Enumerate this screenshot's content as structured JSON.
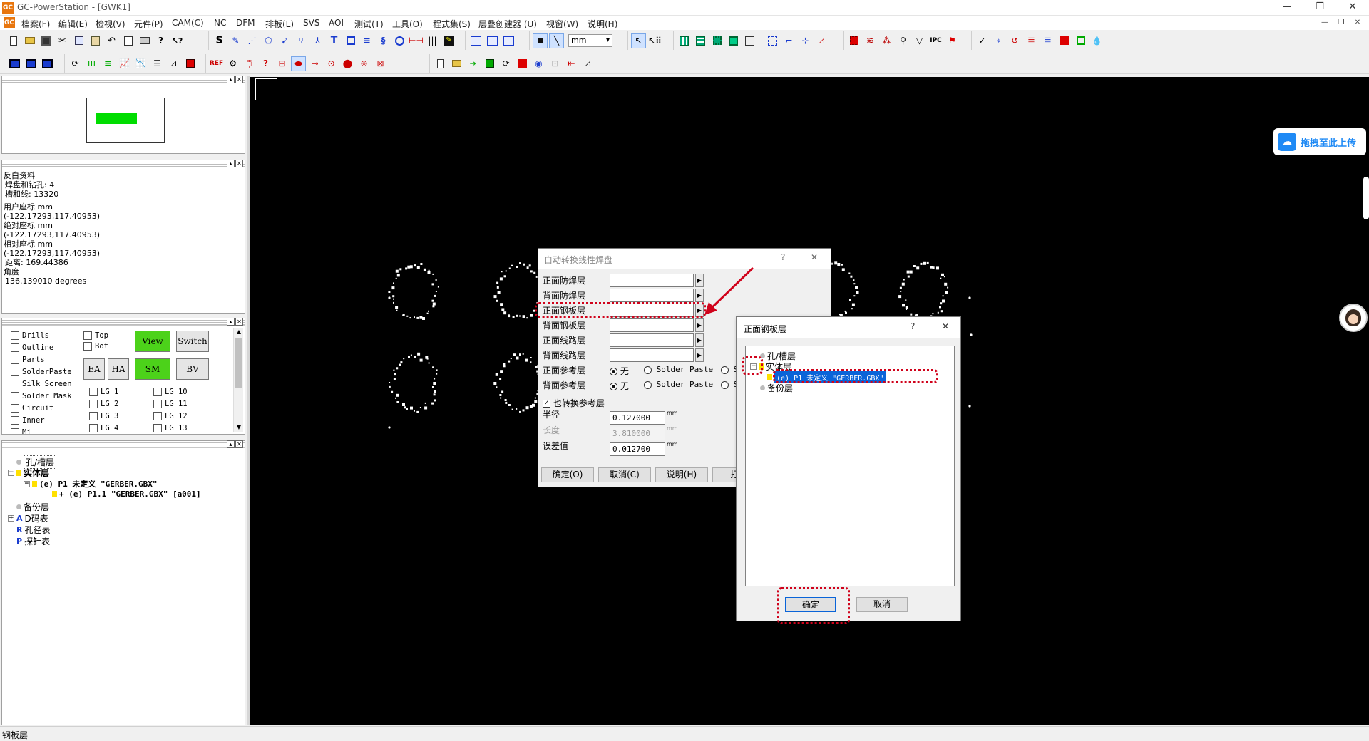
{
  "window": {
    "app_icon": "GC",
    "title": "GC-PowerStation - [GWK1]",
    "controls": [
      "—",
      "❐",
      "✕"
    ]
  },
  "menu": [
    "档案(F)",
    "编辑(E)",
    "检视(V)",
    "元件(P)",
    "CAM(C)",
    "NC",
    "DFM",
    "排板(L)",
    "SVS",
    "AOI",
    "测试(T)",
    "工具(O)",
    "程式集(S)",
    "层叠创建器 (U)",
    "视窗(W)",
    "说明(H)"
  ],
  "toolbar": {
    "unit_select": "mm"
  },
  "overview": {
    "accent": "#00dd00"
  },
  "info": {
    "lines": [
      "反白资料",
      " 焊盘和钻孔: 4",
      " 槽和线: 13320",
      "用户座标 mm",
      "(-122.17293,117.40953)",
      "绝对座标 mm",
      "(-122.17293,117.40953)",
      "相对座标 mm",
      " (-122.17293,117.40953)",
      " 距离: 169.44386",
      "角度",
      " 136.139010 degrees"
    ]
  },
  "layers_panel": {
    "checkboxes": [
      "Drills",
      "Outline",
      "Parts",
      "SolderPaste",
      "Silk Screen",
      "Solder Mask",
      "Circuit",
      "Inner",
      "Mi"
    ],
    "side": [
      "Top",
      "Bot"
    ],
    "buttons": {
      "view": "View",
      "switch": "Switch",
      "ea": "EA",
      "ha": "HA",
      "sm": "SM",
      "bv": "BV"
    },
    "lg_a": [
      "LG 1",
      "LG 2",
      "LG 3",
      "LG 4"
    ],
    "lg_b": [
      "LG 10",
      "LG 11",
      "LG 12",
      "LG 13"
    ]
  },
  "tree": {
    "hole_layer": "孔/槽层",
    "solid_layer": "实体层",
    "p1": "(e) P1 未定义 \"GERBER.GBX\"",
    "p1_1": "+ (e) P1.1 \"GERBER.GBX\" [a001]",
    "backup": "备份层",
    "dcode": "D码表",
    "hole_table": "孔径表",
    "probe_table": "探针表"
  },
  "status": {
    "text": "钢板层"
  },
  "cloud": {
    "label": "拖拽至此上传"
  },
  "dialog_main": {
    "title": "自动转换线性焊盘",
    "help": "?",
    "close": "✕",
    "rows": [
      "正面防焊层",
      "背面防焊层",
      "正面钢板层",
      "背面钢板层",
      "正面线路层",
      "背面线路层"
    ],
    "ref_front": "正面参考层",
    "ref_back": "背面参考层",
    "opt_none": "无",
    "opt_paste": "Solder Paste",
    "opt_s": "S",
    "also_ref": "也转换参考层",
    "radius_label": "半径",
    "radius_value": "0.127000",
    "length_label": "长度",
    "length_value": "3.810000",
    "tol_label": "误差值",
    "tol_value": "0.012700",
    "unit": "mm",
    "btn_ok": "确定(O)",
    "btn_cancel": "取消(C)",
    "btn_help": "说明(H)",
    "btn_print": "打印"
  },
  "dialog_layer": {
    "title": "正面钢板层",
    "help": "?",
    "close": "✕",
    "hole_layer": "孔/槽层",
    "solid_layer": "实体层",
    "selected": "(e) P1 未定义 \"GERBER.GBX\"",
    "backup": "备份层",
    "btn_ok": "确定",
    "btn_cancel": "取消"
  },
  "colors": {
    "annotation": "#d0021b",
    "selection": "#0a64d8",
    "green": "#4cd21a"
  }
}
